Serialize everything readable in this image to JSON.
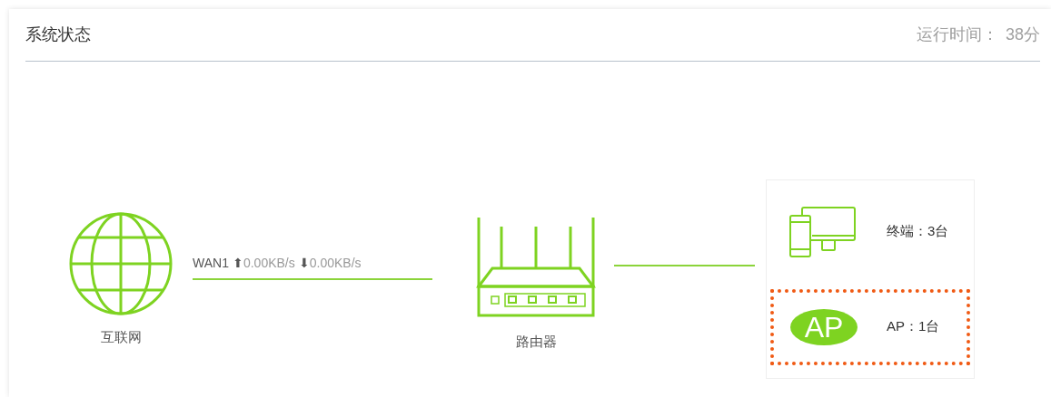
{
  "title": "系统状态",
  "uptime": {
    "label": "运行时间：",
    "value": "38分"
  },
  "internet": {
    "label": "互联网"
  },
  "wan": {
    "name": "WAN1",
    "up_arrow": "⬆",
    "upload": "0.00KB/s",
    "down_arrow": "⬇",
    "download": "0.00KB/s"
  },
  "router": {
    "label": "路由器"
  },
  "devices": [
    {
      "kind": "terminal",
      "label": "终端：3台",
      "highlighted": false
    },
    {
      "kind": "ap",
      "logo": "AP",
      "label": "AP：1台",
      "highlighted": true
    }
  ]
}
